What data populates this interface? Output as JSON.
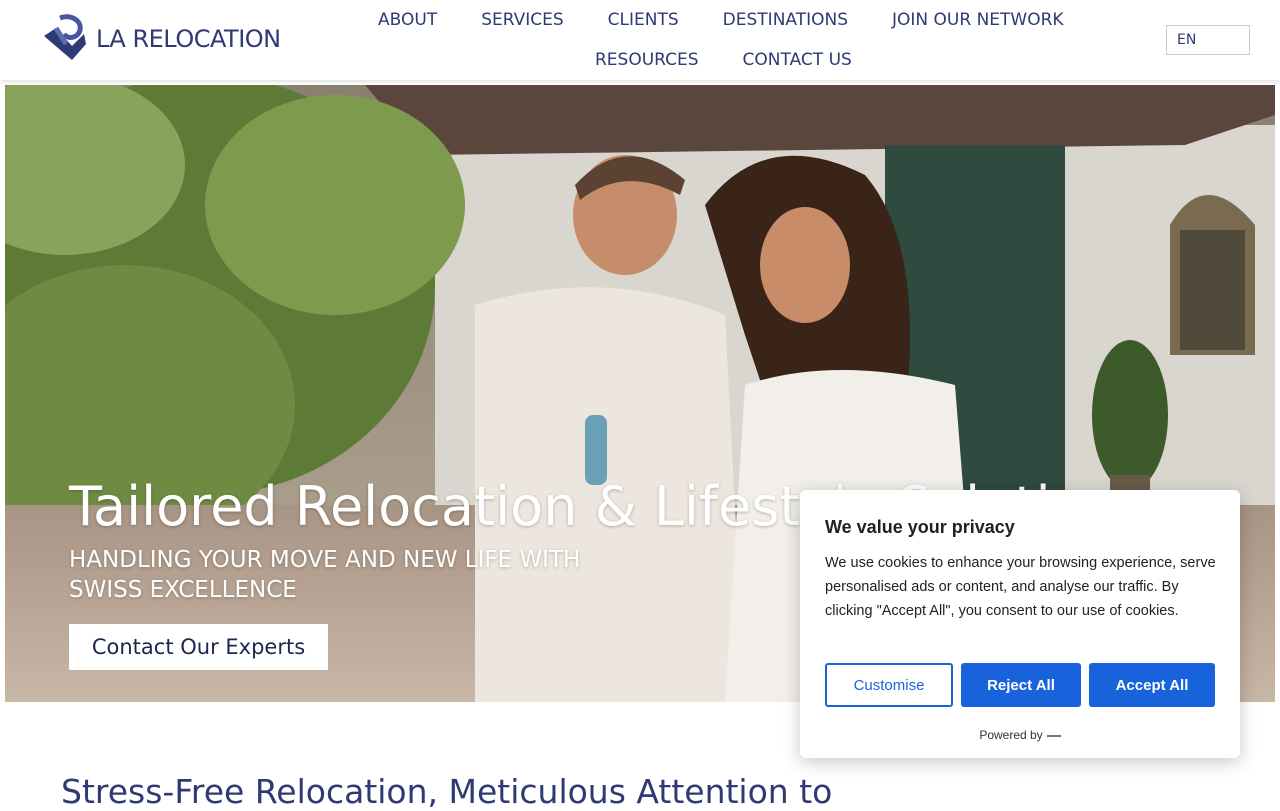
{
  "header": {
    "logo_text": "LA RELOCATION",
    "nav_row1": [
      "ABOUT",
      "SERVICES",
      "CLIENTS",
      "DESTINATIONS",
      "JOIN OUR NETWORK"
    ],
    "nav_row2": [
      "RESOURCES",
      "CONTACT US"
    ],
    "language": "EN"
  },
  "hero": {
    "title": "Tailored Relocation & Lifestyle Soluti",
    "subtitle": "HANDLING YOUR MOVE AND NEW LIFE WITH SWISS EXCELLENCE",
    "cta_label": "Contact Our Experts"
  },
  "section": {
    "title": "Stress-Free Relocation, Meticulous Attention to"
  },
  "cookie": {
    "title": "We value your privacy",
    "text": "We use cookies to enhance your browsing experience, serve personalised ads or content, and analyse our traffic. By clicking \"Accept All\", you consent to our use of cookies.",
    "customise_label": "Customise",
    "reject_label": "Reject All",
    "accept_label": "Accept All",
    "powered_by": "Powered by",
    "accent_color": "#1863dc"
  },
  "colors": {
    "brand_navy": "#2e3a73"
  }
}
